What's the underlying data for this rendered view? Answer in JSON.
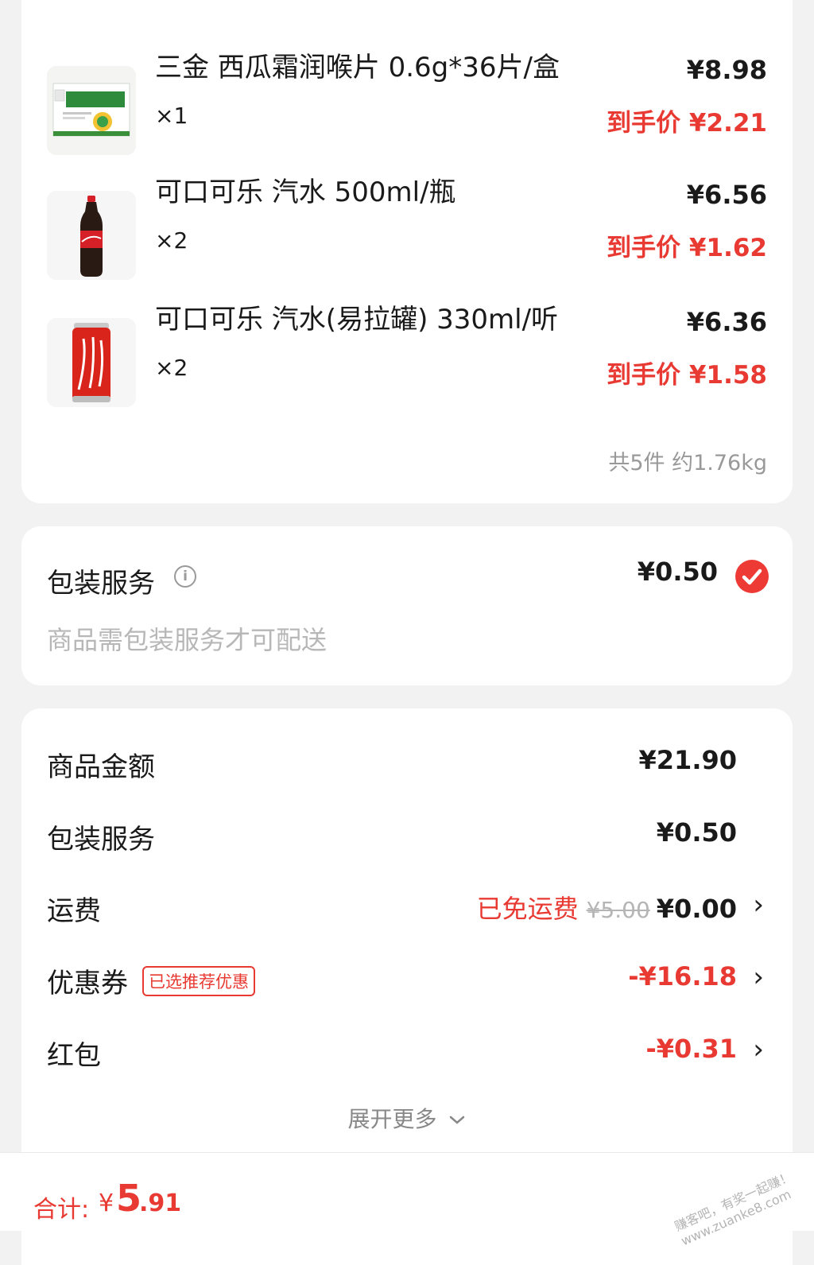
{
  "items": [
    {
      "name": "三金 西瓜霜润喉片 0.6g*36片/盒",
      "qty": "×1",
      "price": "¥8.98",
      "final_label": "到手价 ¥2.21",
      "image_label": "西瓜霜润喉片"
    },
    {
      "name": "可口可乐 汽水 500ml/瓶",
      "qty": "×2",
      "price": "¥6.56",
      "final_label": "到手价 ¥1.62",
      "image_label": "可口可乐"
    },
    {
      "name": "可口可乐 汽水(易拉罐) 330ml/听",
      "qty": "×2",
      "price": "¥6.36",
      "final_label": "到手价 ¥1.58",
      "image_label": "可口可乐"
    }
  ],
  "items_total": "共5件 约1.76kg",
  "packaging": {
    "title": "包装服务",
    "info_icon": "i",
    "price": "¥0.50",
    "desc": "商品需包装服务才可配送",
    "checked": true
  },
  "summary": {
    "goods": {
      "label": "商品金额",
      "value": "¥21.90"
    },
    "pack": {
      "label": "包装服务",
      "value": "¥0.50"
    },
    "shipping": {
      "label": "运费",
      "free_tag": "已免运费",
      "original": "¥5.00",
      "value": "¥0.00"
    },
    "coupon": {
      "label": "优惠券",
      "badge": "已选推荐优惠",
      "value": "-¥16.18"
    },
    "redpacket": {
      "label": "红包",
      "value": "-¥0.31"
    },
    "expand_label": "展开更多",
    "chevron": "›"
  },
  "footer": {
    "total_label": "合计:",
    "currency": "¥",
    "total_int": "5",
    "total_dec": ".91",
    "watermark_line1": "赚客吧，有奖一起赚！",
    "watermark_line2": "www.zuanke8.com"
  },
  "colors": {
    "accent": "#e83a32",
    "muted": "#999999",
    "bg": "#f2f2f2"
  }
}
